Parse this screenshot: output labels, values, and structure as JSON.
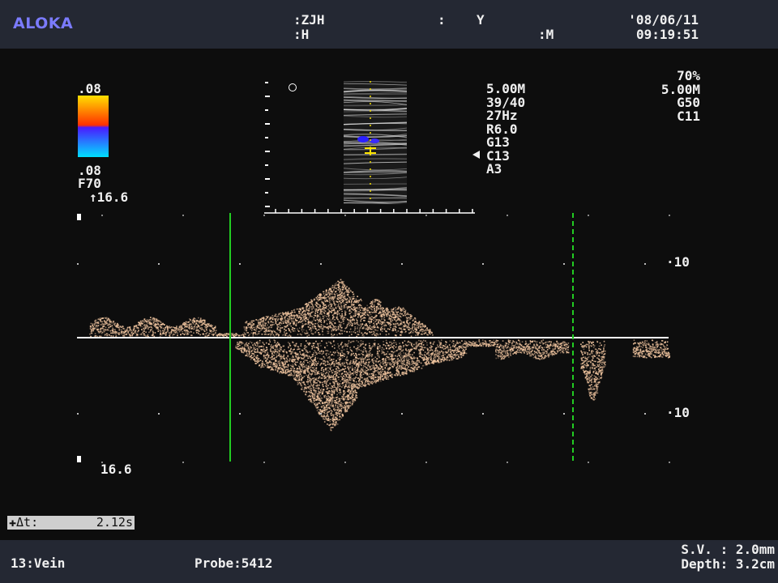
{
  "header": {
    "brand": "ALOKA",
    "name_label": ":ZJH",
    "id_label": ":H",
    "sex_sep": ":",
    "sex_value": "Y",
    "m_label": ":M",
    "date": "'08/06/11",
    "time": "09:19:51"
  },
  "color_scale": {
    "top_value": ".08",
    "bottom_value": ".08",
    "filter": "F70",
    "velocity": "↑16.6",
    "colors": [
      "#ffe000",
      "#ff3000",
      "#4a1aff",
      "#00e0ff"
    ]
  },
  "params_center": [
    "5.00M",
    "39/40",
    "27Hz",
    "R6.0",
    "G13",
    "C13",
    "A3"
  ],
  "params_right": [
    "70%",
    "5.00M",
    "G50",
    "C11"
  ],
  "spectrum": {
    "scale_top": "10",
    "scale_bottom": "10",
    "velocity_range": "16.6",
    "baseline_color": "#ffffff",
    "cursor_color": "#22cc22",
    "spectrum_color": "#f2c6a0"
  },
  "measure": {
    "label": "Δt:",
    "value": "2.12s"
  },
  "footer": {
    "preset": "13:Vein",
    "probe": "Probe:5412",
    "sample_volume": "S.V. : 2.0mm",
    "depth": "Depth: 3.2cm"
  }
}
